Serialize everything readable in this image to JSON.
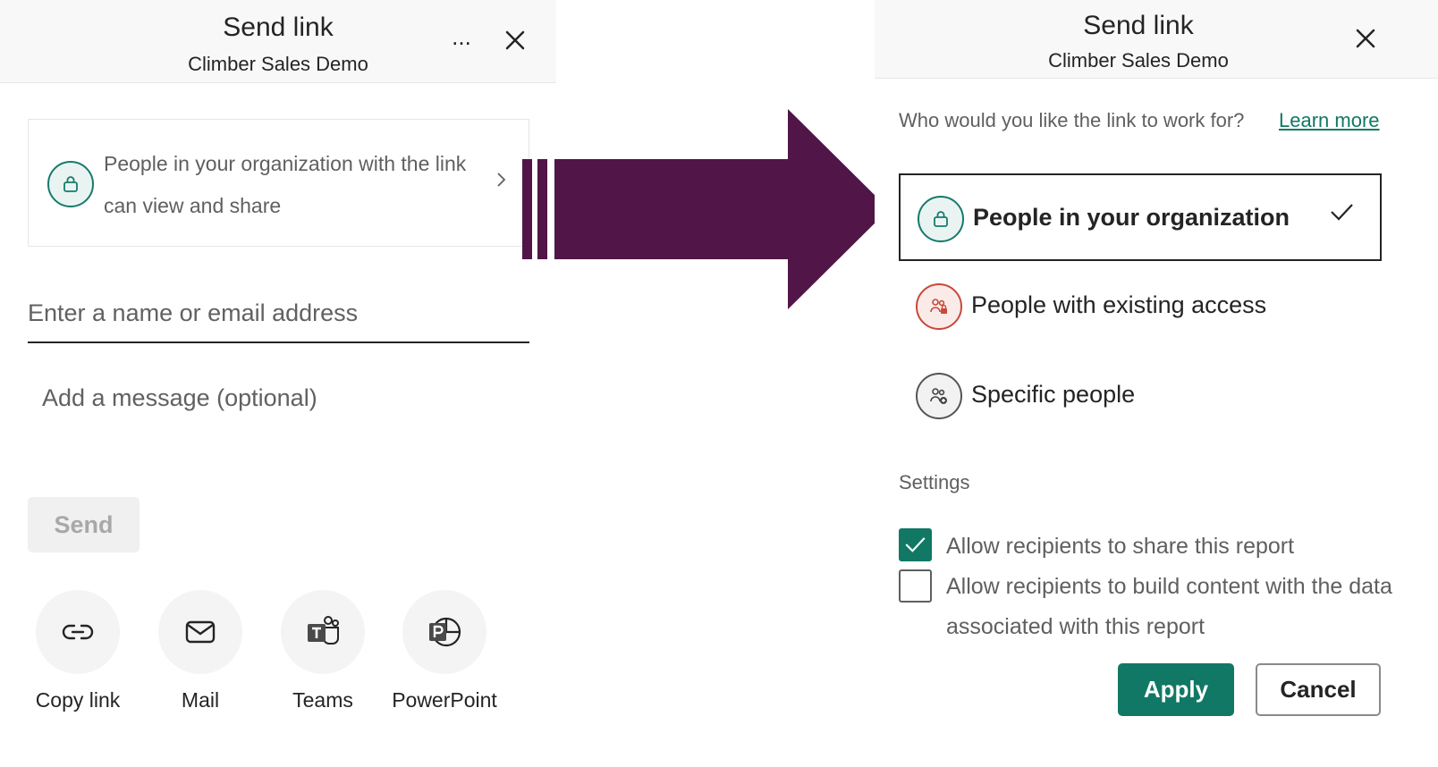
{
  "left_panel": {
    "title": "Send link",
    "subtitle": "Climber Sales Demo",
    "more_label": "...",
    "permission_summary": "People in your organization with the link can view and share",
    "email_placeholder": "Enter a name or email address",
    "message_placeholder": "Add a message (optional)",
    "send_label": "Send",
    "share_options": [
      {
        "label": "Copy link",
        "icon": "link-icon"
      },
      {
        "label": "Mail",
        "icon": "mail-icon"
      },
      {
        "label": "Teams",
        "icon": "teams-icon"
      },
      {
        "label": "PowerPoint",
        "icon": "powerpoint-icon"
      }
    ]
  },
  "right_panel": {
    "title": "Send link",
    "subtitle": "Climber Sales Demo",
    "question": "Who would you like the link to work for?",
    "learn_more": "Learn more",
    "options": [
      {
        "label": "People in your organization",
        "icon": "lock-icon",
        "selected": true
      },
      {
        "label": "People with existing access",
        "icon": "people-lock-icon",
        "selected": false
      },
      {
        "label": "Specific people",
        "icon": "people-add-icon",
        "selected": false
      }
    ],
    "settings_heading": "Settings",
    "settings": [
      {
        "label": "Allow recipients to share this report",
        "checked": true
      },
      {
        "label": "Allow recipients to build content with the data associated with this report",
        "checked": false
      }
    ],
    "apply_label": "Apply",
    "cancel_label": "Cancel"
  },
  "colors": {
    "accent": "#117865",
    "arrow": "#511547",
    "existing_access": "#c9483a"
  }
}
